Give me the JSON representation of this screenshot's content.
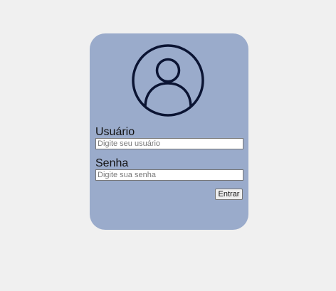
{
  "login": {
    "avatar_icon": "user-circle-icon",
    "username_label": "Usuário",
    "username_placeholder": "Digite seu usuário",
    "username_value": "",
    "password_label": "Senha",
    "password_placeholder": "Digite sua senha",
    "password_value": "",
    "submit_label": "Entrar"
  },
  "colors": {
    "page_background": "#f0f0f0",
    "card_background": "#9aabcb",
    "icon_stroke": "#0b1433"
  }
}
